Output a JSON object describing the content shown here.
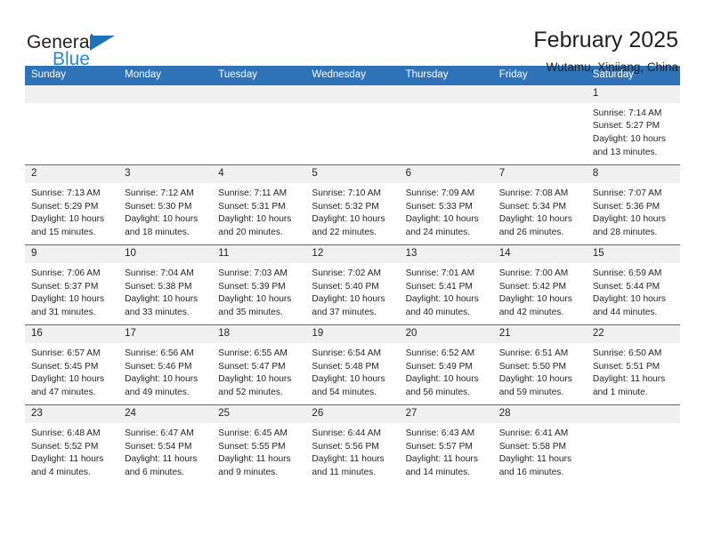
{
  "logo": {
    "word1": "General",
    "word2": "Blue",
    "triangle_color": "#1f71b8",
    "blue_color": "#2a8ad4"
  },
  "header": {
    "title": "February 2025",
    "subtitle": "Wutamu, Xinjiang, China"
  },
  "theme": {
    "header_blue": "#2e72b8",
    "daynum_bg": "#f0f0f0",
    "text": "#231f20"
  },
  "weekdays": [
    "Sunday",
    "Monday",
    "Tuesday",
    "Wednesday",
    "Thursday",
    "Friday",
    "Saturday"
  ],
  "labels": {
    "sunrise": "Sunrise:",
    "sunset": "Sunset:",
    "daylight": "Daylight:"
  },
  "weeks": [
    [
      {
        "day": "",
        "blank": true
      },
      {
        "day": "",
        "blank": true
      },
      {
        "day": "",
        "blank": true
      },
      {
        "day": "",
        "blank": true
      },
      {
        "day": "",
        "blank": true
      },
      {
        "day": "",
        "blank": true
      },
      {
        "day": "1",
        "sunrise": "Sunrise: 7:14 AM",
        "sunset": "Sunset: 5:27 PM",
        "daylight": "Daylight: 10 hours and 13 minutes."
      }
    ],
    [
      {
        "day": "2",
        "sunrise": "Sunrise: 7:13 AM",
        "sunset": "Sunset: 5:29 PM",
        "daylight": "Daylight: 10 hours and 15 minutes."
      },
      {
        "day": "3",
        "sunrise": "Sunrise: 7:12 AM",
        "sunset": "Sunset: 5:30 PM",
        "daylight": "Daylight: 10 hours and 18 minutes."
      },
      {
        "day": "4",
        "sunrise": "Sunrise: 7:11 AM",
        "sunset": "Sunset: 5:31 PM",
        "daylight": "Daylight: 10 hours and 20 minutes."
      },
      {
        "day": "5",
        "sunrise": "Sunrise: 7:10 AM",
        "sunset": "Sunset: 5:32 PM",
        "daylight": "Daylight: 10 hours and 22 minutes."
      },
      {
        "day": "6",
        "sunrise": "Sunrise: 7:09 AM",
        "sunset": "Sunset: 5:33 PM",
        "daylight": "Daylight: 10 hours and 24 minutes."
      },
      {
        "day": "7",
        "sunrise": "Sunrise: 7:08 AM",
        "sunset": "Sunset: 5:34 PM",
        "daylight": "Daylight: 10 hours and 26 minutes."
      },
      {
        "day": "8",
        "sunrise": "Sunrise: 7:07 AM",
        "sunset": "Sunset: 5:36 PM",
        "daylight": "Daylight: 10 hours and 28 minutes."
      }
    ],
    [
      {
        "day": "9",
        "sunrise": "Sunrise: 7:06 AM",
        "sunset": "Sunset: 5:37 PM",
        "daylight": "Daylight: 10 hours and 31 minutes."
      },
      {
        "day": "10",
        "sunrise": "Sunrise: 7:04 AM",
        "sunset": "Sunset: 5:38 PM",
        "daylight": "Daylight: 10 hours and 33 minutes."
      },
      {
        "day": "11",
        "sunrise": "Sunrise: 7:03 AM",
        "sunset": "Sunset: 5:39 PM",
        "daylight": "Daylight: 10 hours and 35 minutes."
      },
      {
        "day": "12",
        "sunrise": "Sunrise: 7:02 AM",
        "sunset": "Sunset: 5:40 PM",
        "daylight": "Daylight: 10 hours and 37 minutes."
      },
      {
        "day": "13",
        "sunrise": "Sunrise: 7:01 AM",
        "sunset": "Sunset: 5:41 PM",
        "daylight": "Daylight: 10 hours and 40 minutes."
      },
      {
        "day": "14",
        "sunrise": "Sunrise: 7:00 AM",
        "sunset": "Sunset: 5:42 PM",
        "daylight": "Daylight: 10 hours and 42 minutes."
      },
      {
        "day": "15",
        "sunrise": "Sunrise: 6:59 AM",
        "sunset": "Sunset: 5:44 PM",
        "daylight": "Daylight: 10 hours and 44 minutes."
      }
    ],
    [
      {
        "day": "16",
        "sunrise": "Sunrise: 6:57 AM",
        "sunset": "Sunset: 5:45 PM",
        "daylight": "Daylight: 10 hours and 47 minutes."
      },
      {
        "day": "17",
        "sunrise": "Sunrise: 6:56 AM",
        "sunset": "Sunset: 5:46 PM",
        "daylight": "Daylight: 10 hours and 49 minutes."
      },
      {
        "day": "18",
        "sunrise": "Sunrise: 6:55 AM",
        "sunset": "Sunset: 5:47 PM",
        "daylight": "Daylight: 10 hours and 52 minutes."
      },
      {
        "day": "19",
        "sunrise": "Sunrise: 6:54 AM",
        "sunset": "Sunset: 5:48 PM",
        "daylight": "Daylight: 10 hours and 54 minutes."
      },
      {
        "day": "20",
        "sunrise": "Sunrise: 6:52 AM",
        "sunset": "Sunset: 5:49 PM",
        "daylight": "Daylight: 10 hours and 56 minutes."
      },
      {
        "day": "21",
        "sunrise": "Sunrise: 6:51 AM",
        "sunset": "Sunset: 5:50 PM",
        "daylight": "Daylight: 10 hours and 59 minutes."
      },
      {
        "day": "22",
        "sunrise": "Sunrise: 6:50 AM",
        "sunset": "Sunset: 5:51 PM",
        "daylight": "Daylight: 11 hours and 1 minute."
      }
    ],
    [
      {
        "day": "23",
        "sunrise": "Sunrise: 6:48 AM",
        "sunset": "Sunset: 5:52 PM",
        "daylight": "Daylight: 11 hours and 4 minutes."
      },
      {
        "day": "24",
        "sunrise": "Sunrise: 6:47 AM",
        "sunset": "Sunset: 5:54 PM",
        "daylight": "Daylight: 11 hours and 6 minutes."
      },
      {
        "day": "25",
        "sunrise": "Sunrise: 6:45 AM",
        "sunset": "Sunset: 5:55 PM",
        "daylight": "Daylight: 11 hours and 9 minutes."
      },
      {
        "day": "26",
        "sunrise": "Sunrise: 6:44 AM",
        "sunset": "Sunset: 5:56 PM",
        "daylight": "Daylight: 11 hours and 11 minutes."
      },
      {
        "day": "27",
        "sunrise": "Sunrise: 6:43 AM",
        "sunset": "Sunset: 5:57 PM",
        "daylight": "Daylight: 11 hours and 14 minutes."
      },
      {
        "day": "28",
        "sunrise": "Sunrise: 6:41 AM",
        "sunset": "Sunset: 5:58 PM",
        "daylight": "Daylight: 11 hours and 16 minutes."
      },
      {
        "day": "",
        "blank": true
      }
    ]
  ]
}
